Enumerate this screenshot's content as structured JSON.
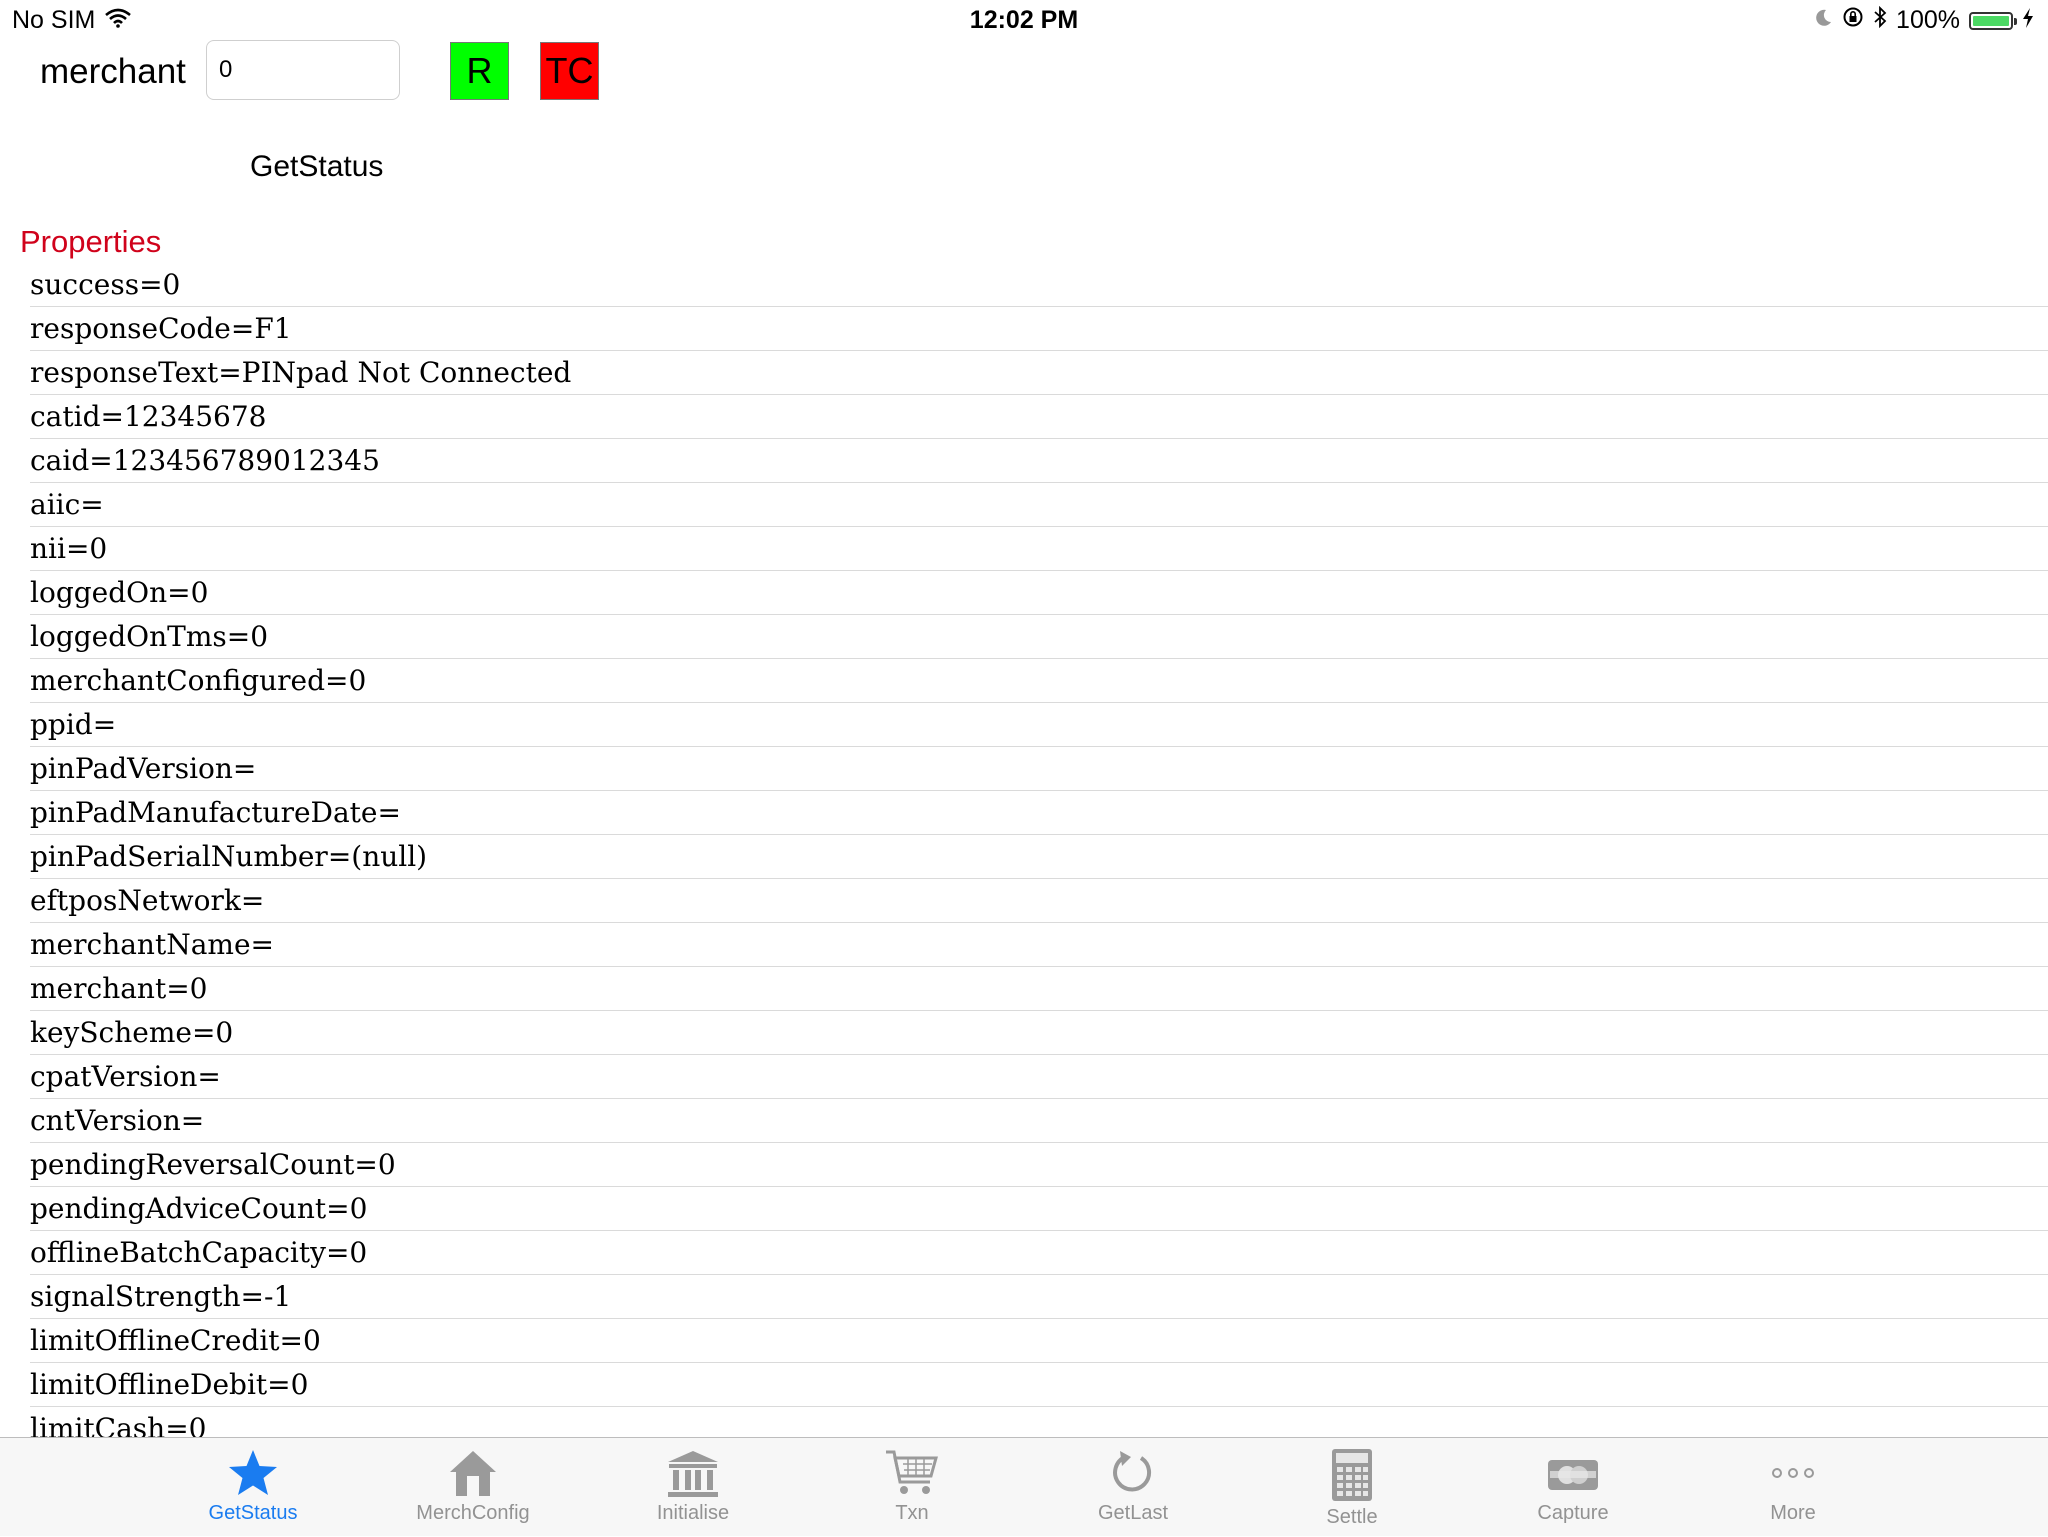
{
  "status": {
    "carrier": "No SIM",
    "time": "12:02 PM",
    "battery": "100%"
  },
  "header": {
    "merchant_label": "merchant",
    "merchant_value": "0",
    "r_label": "R",
    "tc_label": "TC",
    "r_color": "#00ff00",
    "tc_color": "#ff0000",
    "action_label": "GetStatus"
  },
  "section_title": "Properties",
  "accent_color": "#d0021b",
  "properties": [
    "success=0",
    "responseCode=F1",
    "responseText=PINpad Not Connected",
    "catid=12345678",
    "caid=123456789012345",
    "aiic=",
    "nii=0",
    "loggedOn=0",
    "loggedOnTms=0",
    "merchantConfigured=0",
    "ppid=",
    "pinPadVersion=",
    "pinPadManufactureDate=",
    "pinPadSerialNumber=(null)",
    "eftposNetwork=",
    "merchantName=",
    "merchant=0",
    "keyScheme=0",
    "cpatVersion=",
    "cntVersion=",
    "pendingReversalCount=0",
    "pendingAdviceCount=0",
    "offlineBatchCapacity=0",
    "signalStrength=-1",
    "limitOfflineCredit=0",
    "limitOfflineDebit=0",
    "limitCash=0"
  ],
  "tabs": [
    {
      "label": "GetStatus",
      "icon": "star-icon",
      "active": true
    },
    {
      "label": "MerchConfig",
      "icon": "house-icon",
      "active": false
    },
    {
      "label": "Initialise",
      "icon": "bank-icon",
      "active": false
    },
    {
      "label": "Txn",
      "icon": "cart-icon",
      "active": false
    },
    {
      "label": "GetLast",
      "icon": "refresh-icon",
      "active": false
    },
    {
      "label": "Settle",
      "icon": "calculator-icon",
      "active": false
    },
    {
      "label": "Capture",
      "icon": "card-icon",
      "active": false
    },
    {
      "label": "More",
      "icon": "more-icon",
      "active": false
    }
  ]
}
